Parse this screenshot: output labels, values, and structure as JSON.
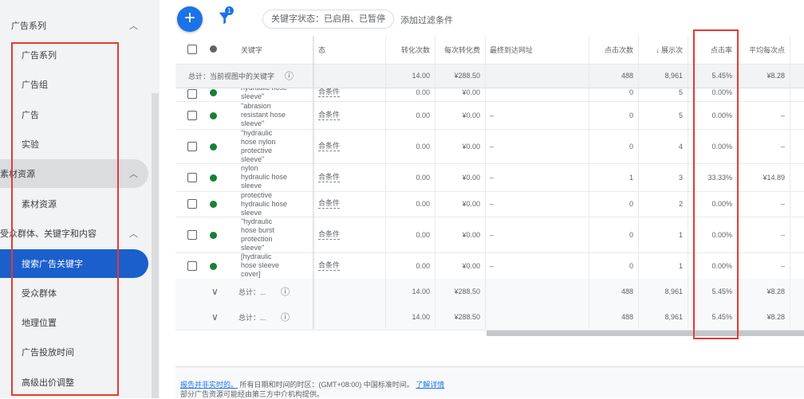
{
  "sidebar": {
    "sections": [
      {
        "label": "广告系列",
        "expanded": true
      },
      {
        "label": "素材资源",
        "expanded": true
      },
      {
        "label": "受众群体、关键字和内容",
        "expanded": true
      }
    ],
    "items": [
      {
        "label": "广告系列"
      },
      {
        "label": "广告组"
      },
      {
        "label": "广告"
      },
      {
        "label": "实验"
      },
      {
        "label": "素材资源"
      },
      {
        "label": "搜索广告关键字",
        "active": true
      },
      {
        "label": "受众群体"
      },
      {
        "label": "地理位置"
      },
      {
        "label": "广告投放时间"
      },
      {
        "label": "高级出价调整"
      }
    ]
  },
  "toolbar": {
    "add_icon": "plus-icon",
    "filter_badge": "1",
    "filter_chip": "关键字状态：已启用、已暂停",
    "add_filter": "添加过滤条件"
  },
  "table": {
    "columns": [
      "关键字",
      "态",
      "转化次数",
      "每次转化费",
      "最终到达网址",
      "点击次数",
      "↓ 展示次",
      "点击率",
      "平均每次点"
    ],
    "summary": {
      "label": "总计：当前视图中的关键字",
      "conv": "14.00",
      "cpconv": "¥288.50",
      "clicks": "488",
      "impr": "8,961",
      "ctr": "5.45%",
      "avgcpc": "¥8.28"
    },
    "rows": [
      {
        "keyword": "hydraulic hose\nsleeve\"",
        "status": "合条件",
        "conv": "0.00",
        "cpconv": "¥0.00",
        "url": "",
        "clicks": "0",
        "impr": "5",
        "ctr": "0.00%",
        "avgcpc": "",
        "partial": true
      },
      {
        "keyword": "\"abrasion\nresistant hose\nsleeve\"",
        "status": "合条件",
        "conv": "0.00",
        "cpconv": "¥0.00",
        "url": "–",
        "clicks": "0",
        "impr": "5",
        "ctr": "0.00%",
        "avgcpc": "–"
      },
      {
        "keyword": "\"hydraulic\nhose nylon\nprotective\nsleeve\"",
        "status": "合条件",
        "conv": "0.00",
        "cpconv": "¥0.00",
        "url": "–",
        "clicks": "0",
        "impr": "4",
        "ctr": "0.00%",
        "avgcpc": "–"
      },
      {
        "keyword": "nylon\nhydraulic hose\nsleeve",
        "status": "合条件",
        "conv": "0.00",
        "cpconv": "¥0.00",
        "url": "–",
        "clicks": "1",
        "impr": "3",
        "ctr": "33.33%",
        "avgcpc": "¥14.89"
      },
      {
        "keyword": "protective\nhydraulic hose\nsleeve",
        "status": "合条件",
        "conv": "0.00",
        "cpconv": "¥0.00",
        "url": "–",
        "clicks": "0",
        "impr": "2",
        "ctr": "0.00%",
        "avgcpc": "–"
      },
      {
        "keyword": "\"hydraulic\nhose burst\nprotection\nsleeve\"",
        "status": "合条件",
        "conv": "0.00",
        "cpconv": "¥0.00",
        "url": "–",
        "clicks": "0",
        "impr": "1",
        "ctr": "0.00%",
        "avgcpc": "–"
      },
      {
        "keyword": "[hydraulic\nhose sleeve\ncover]",
        "status": "合条件",
        "conv": "0.00",
        "cpconv": "¥0.00",
        "url": "–",
        "clicks": "0",
        "impr": "1",
        "ctr": "0.00%",
        "avgcpc": "–"
      }
    ],
    "totals": [
      {
        "label": "总计：...",
        "conv": "14.00",
        "cpconv": "¥288.50",
        "clicks": "488",
        "impr": "8,961",
        "ctr": "5.45%",
        "avgcpc": "¥8.28"
      },
      {
        "label": "总计：...",
        "conv": "14.00",
        "cpconv": "¥288.50",
        "clicks": "488",
        "impr": "8,961",
        "ctr": "5.45%",
        "avgcpc": "¥8.28"
      }
    ]
  },
  "footer": {
    "link1": "报告并非实时的。",
    "text1": " 所有日期和时间的时区：(GMT+08:00) 中国标准时间。 ",
    "link2": "了解详情",
    "text2": "部分广告资源可能经由第三方中介机构提供。"
  },
  "colors": {
    "accent": "#1a73e8",
    "active_nav": "#1a5fcc",
    "enabled_dot": "#188038",
    "highlight_box": "#e53935"
  }
}
